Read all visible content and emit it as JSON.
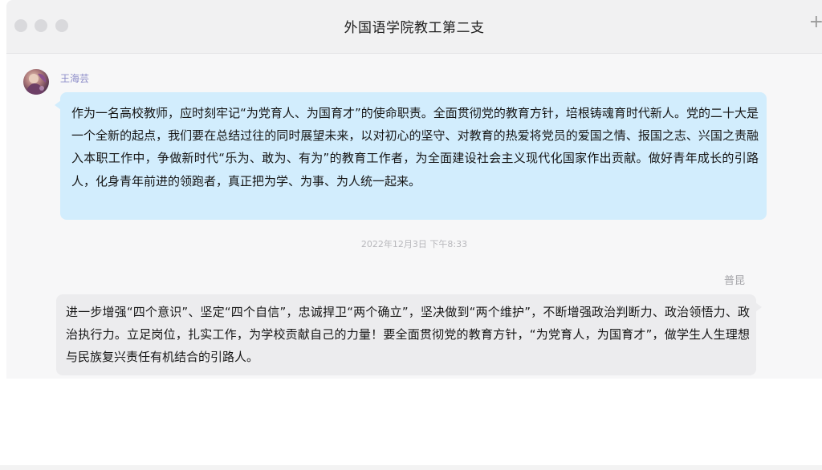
{
  "window": {
    "title": "外国语学院教工第二支"
  },
  "toolbar": {
    "plus_icon": "plus-icon"
  },
  "messages": [
    {
      "sender": "王海芸",
      "side": "left",
      "text": "作为一名高校教师，应时刻牢记“为党育人、为国育才”的使命职责。全面贯彻党的教育方针，培根铸魂育时代新人。党的二十大是一个全新的起点，我们要在总结过往的同时展望未来，以对初心的坚守、对教育的热爱将党员的爱国之情、报国之志、兴国之责融入本职工作中，争做新时代“乐为、敢为、有为”的教育工作者，为全面建设社会主义现代化国家作出贡献。做好青年成长的引路人，化身青年前进的领跑者，真正把为学、为事、为人统一起来。"
    },
    {
      "sender": "普昆",
      "side": "right",
      "text": "进一步增强“四个意识”、坚定“四个自信”，忠诚捍卫“两个确立”，坚决做到“两个维护”，不断增强政治判断力、政治领悟力、政治执行力。立足岗位，扎实工作，为学校贡献自己的力量！要全面贯彻党的教育方针，“为党育人，为国育才”，做学生人生理想与民族复兴责任有机结合的引路人。"
    }
  ],
  "timestamp": "2022年12月3日  下午8:33",
  "colors": {
    "left_bubble": "#d2edfd",
    "right_bubble": "#ececee",
    "sender_name": "#8c8cc8"
  }
}
